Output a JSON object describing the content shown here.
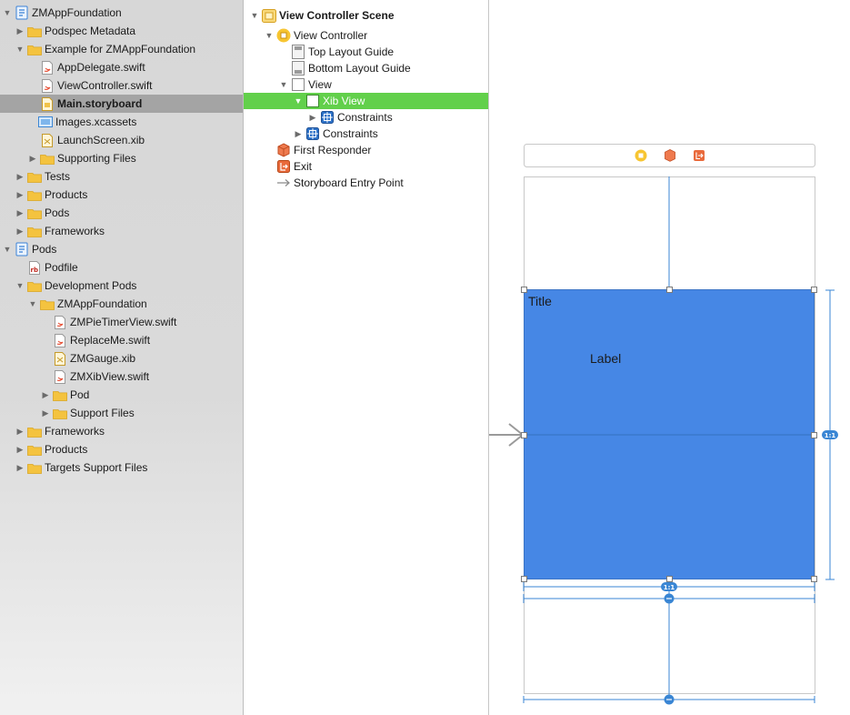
{
  "navigator": {
    "items": [
      {
        "label": "ZMAppFoundation",
        "icon": "project-icon"
      },
      {
        "label": "Podspec Metadata",
        "icon": "folder-icon"
      },
      {
        "label": "Example for ZMAppFoundation",
        "icon": "folder-icon"
      },
      {
        "label": "AppDelegate.swift",
        "icon": "swift-file-icon"
      },
      {
        "label": "ViewController.swift",
        "icon": "swift-file-icon"
      },
      {
        "label": "Main.storyboard",
        "icon": "storyboard-file-icon"
      },
      {
        "label": "Images.xcassets",
        "icon": "asset-catalog-icon"
      },
      {
        "label": "LaunchScreen.xib",
        "icon": "xib-file-icon"
      },
      {
        "label": "Supporting Files",
        "icon": "folder-icon"
      },
      {
        "label": "Tests",
        "icon": "folder-icon"
      },
      {
        "label": "Products",
        "icon": "folder-icon"
      },
      {
        "label": "Pods",
        "icon": "folder-icon"
      },
      {
        "label": "Frameworks",
        "icon": "folder-icon"
      },
      {
        "label": "Pods",
        "icon": "project-icon"
      },
      {
        "label": "Podfile",
        "icon": "ruby-file-icon"
      },
      {
        "label": "Development Pods",
        "icon": "folder-icon"
      },
      {
        "label": "ZMAppFoundation",
        "icon": "folder-icon"
      },
      {
        "label": "ZMPieTimerView.swift",
        "icon": "swift-file-icon"
      },
      {
        "label": "ReplaceMe.swift",
        "icon": "swift-file-icon"
      },
      {
        "label": "ZMGauge.xib",
        "icon": "xib-file-icon"
      },
      {
        "label": "ZMXibView.swift",
        "icon": "swift-file-icon"
      },
      {
        "label": "Pod",
        "icon": "folder-icon"
      },
      {
        "label": "Support Files",
        "icon": "folder-icon"
      },
      {
        "label": "Frameworks",
        "icon": "folder-icon"
      },
      {
        "label": "Products",
        "icon": "folder-icon"
      },
      {
        "label": "Targets Support Files",
        "icon": "folder-icon"
      }
    ],
    "selected_label": "Main.storyboard"
  },
  "outline": {
    "items": [
      {
        "label": "View Controller Scene",
        "icon": "scene-icon"
      },
      {
        "label": "View Controller",
        "icon": "view-controller-icon"
      },
      {
        "label": "Top Layout Guide",
        "icon": "layout-guide-icon"
      },
      {
        "label": "Bottom Layout Guide",
        "icon": "layout-guide-icon"
      },
      {
        "label": "View",
        "icon": "view-icon"
      },
      {
        "label": "Xib View",
        "icon": "view-icon"
      },
      {
        "label": "Constraints",
        "icon": "constraints-icon"
      },
      {
        "label": "Constraints",
        "icon": "constraints-icon"
      },
      {
        "label": "First Responder",
        "icon": "first-responder-icon"
      },
      {
        "label": "Exit",
        "icon": "exit-icon"
      },
      {
        "label": "Storyboard Entry Point",
        "icon": "entry-arrow-icon"
      }
    ],
    "selected_label": "Xib View"
  },
  "canvas": {
    "title_label": "Title",
    "content_label": "Label",
    "ratio_badge_side": "1:1",
    "ratio_badge_bottom": "1:1",
    "scene_dock_icons": [
      "view-controller-icon",
      "first-responder-icon",
      "exit-icon"
    ]
  },
  "colors": {
    "selection_green": "#62d04b",
    "xib_view_blue": "#4687e5",
    "constraint_blue": "#3a86d4",
    "folder_yellow": "#f4c33f",
    "navigator_selected_gray": "#a4a4a4"
  }
}
